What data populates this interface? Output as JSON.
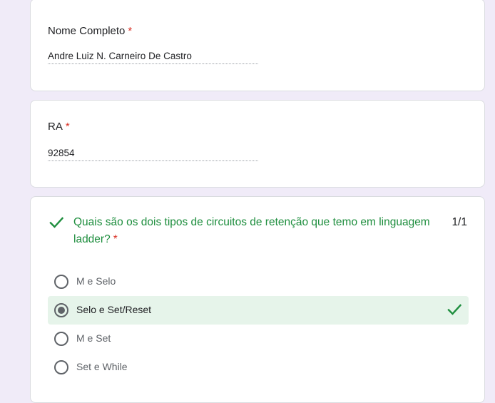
{
  "fields": [
    {
      "label": "Nome Completo",
      "required_mark": "*",
      "value": "Andre Luiz N. Carneiro De Castro"
    },
    {
      "label": "RA",
      "required_mark": "*",
      "value": "92854"
    }
  ],
  "question": {
    "title": "Quais são os dois tipos de circuitos de retenção que temo em linguagem ladder?",
    "required_mark": "*",
    "score": "1/1",
    "options": [
      {
        "label": "M e Selo",
        "selected": false,
        "correct": false
      },
      {
        "label": "Selo e Set/Reset",
        "selected": true,
        "correct": true
      },
      {
        "label": "M e Set",
        "selected": false,
        "correct": false
      },
      {
        "label": "Set e While",
        "selected": false,
        "correct": false
      }
    ]
  },
  "colors": {
    "background": "#f0ebf8",
    "correct_green": "#1e8e3e",
    "correct_bg": "#e6f4ea",
    "required_red": "#d93025"
  },
  "icons": {
    "question_status": "checkmark-icon",
    "option_status": "checkmark-icon"
  }
}
